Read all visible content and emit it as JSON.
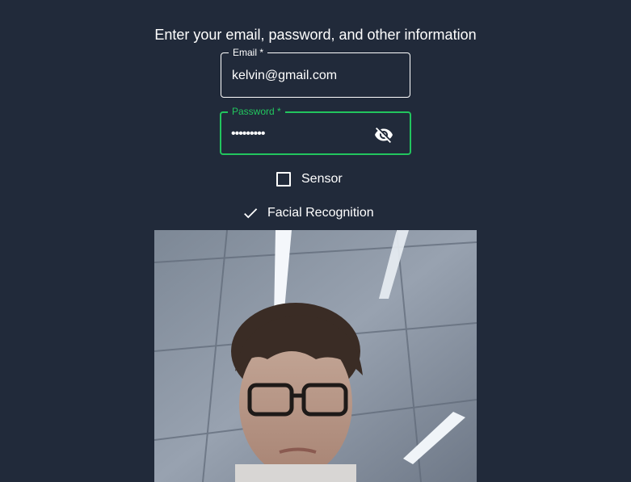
{
  "form": {
    "heading": "Enter your email, password, and other information",
    "email": {
      "label": "Email *",
      "value": "kelvin@gmail.com"
    },
    "password": {
      "label": "Password *",
      "value": "•••••••••",
      "visibility_icon": "visibility-off-icon"
    },
    "options": {
      "sensor_label": "Sensor",
      "sensor_checked": false,
      "facial_label": "Facial Recognition",
      "facial_checked": true
    }
  },
  "colors": {
    "background": "#212a3a",
    "accent_green": "#22c55e",
    "text": "#ffffff"
  },
  "camera": {
    "content": "webcam-feed"
  }
}
